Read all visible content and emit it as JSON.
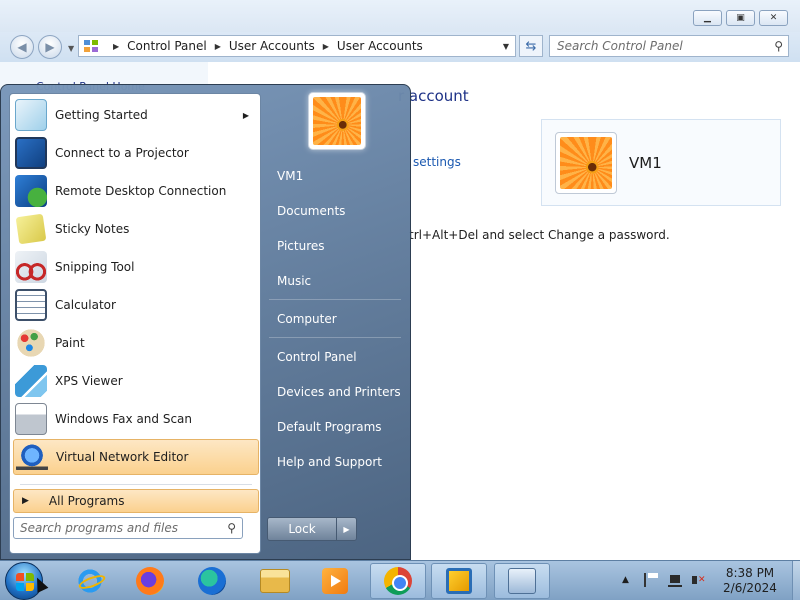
{
  "window": {
    "address": {
      "crumbs": [
        "Control Panel",
        "User Accounts",
        "User Accounts"
      ]
    },
    "search_placeholder": "Search Control Panel",
    "content": {
      "heading_fragment": "r account",
      "link_fragment": "settings",
      "text_fragment": "trl+Alt+Del and select Change a password.",
      "side_ghost": "Control Panel Home",
      "user_card_name": "VM1"
    }
  },
  "start_menu": {
    "programs": [
      {
        "label": "Getting Started",
        "icon": "getting-started-icon",
        "has_submenu": true
      },
      {
        "label": "Connect to a Projector",
        "icon": "projector-icon"
      },
      {
        "label": "Remote Desktop Connection",
        "icon": "remote-desktop-icon"
      },
      {
        "label": "Sticky Notes",
        "icon": "sticky-notes-icon"
      },
      {
        "label": "Snipping Tool",
        "icon": "snipping-tool-icon"
      },
      {
        "label": "Calculator",
        "icon": "calculator-icon"
      },
      {
        "label": "Paint",
        "icon": "paint-icon"
      },
      {
        "label": "XPS Viewer",
        "icon": "xps-viewer-icon"
      },
      {
        "label": "Windows Fax and Scan",
        "icon": "fax-scan-icon"
      },
      {
        "label": "Virtual Network Editor",
        "icon": "virtual-network-editor-icon",
        "highlighted": true
      }
    ],
    "all_programs": "All Programs",
    "search_placeholder": "Search programs and files",
    "right_items": [
      "VM1",
      "Documents",
      "Pictures",
      "Music",
      "Computer",
      "Control Panel",
      "Devices and Printers",
      "Default Programs",
      "Help and Support"
    ],
    "lock_label": "Lock"
  },
  "taskbar": {
    "apps": [
      "internet-explorer-icon",
      "firefox-icon",
      "edge-icon",
      "file-explorer-icon",
      "media-player-icon",
      "chrome-icon",
      "vmware-icon",
      "network-config-icon"
    ],
    "clock_time": "8:38 PM",
    "clock_date": "2/6/2024"
  },
  "colors": {
    "accent_link": "#1a58b0",
    "heading": "#1e3287",
    "highlight": "#fbd18e"
  }
}
